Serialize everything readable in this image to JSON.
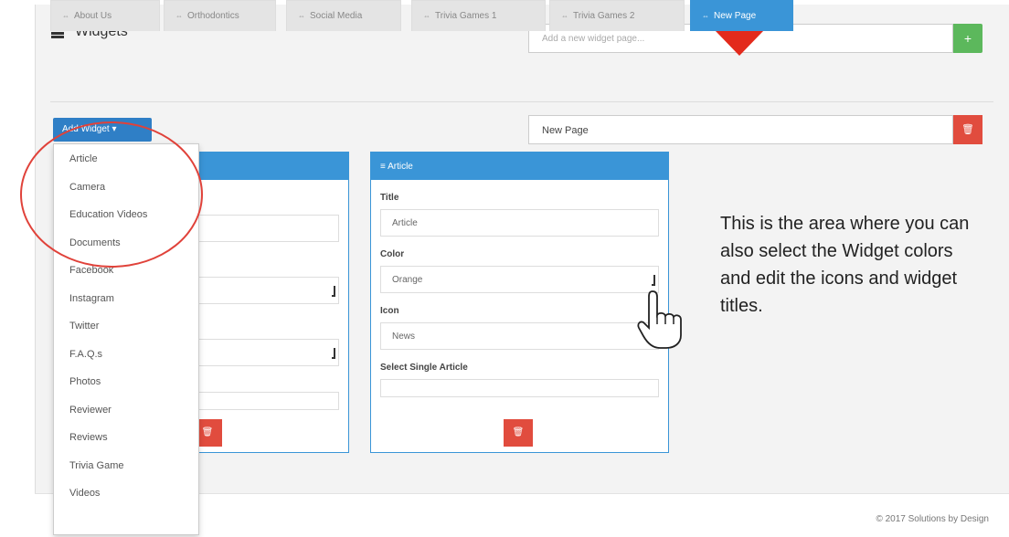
{
  "header": {
    "title": "Widgets",
    "icon": "list-icon"
  },
  "new_page_input": {
    "placeholder": "Add a new widget page..."
  },
  "add_button": {
    "label": "+"
  },
  "tabs": [
    {
      "label": "About Us",
      "active": false
    },
    {
      "label": "Orthodontics",
      "active": false
    },
    {
      "label": "Social Media",
      "active": false
    },
    {
      "label": "Trivia Games 1",
      "active": false
    },
    {
      "label": "Trivia Games 2",
      "active": false
    },
    {
      "label": "New Page",
      "active": true
    }
  ],
  "add_widget": {
    "label": "Add Widget ▾"
  },
  "page_name": {
    "value": "New Page"
  },
  "dropdown_items": [
    "Article",
    "Camera",
    "Education Videos",
    "Documents",
    "Facebook",
    "Instagram",
    "Twitter",
    "F.A.Q.s",
    "Photos",
    "Reviewer",
    "Reviews",
    "Trivia Game",
    "Videos"
  ],
  "widget": {
    "header": "Article",
    "title_label": "Title",
    "title_value": "Article",
    "color_label": "Color",
    "color_value": "Orange",
    "icon_label": "Icon",
    "icon_value": "News",
    "single_label": "Select Single Article"
  },
  "annotation": "This is the area where you can also select the Widget colors and edit the icons and widget titles.",
  "footer": {
    "copyright": "© 2017 Solutions by Design"
  },
  "colors": {
    "primary": "#3a95d7",
    "danger": "#e14c3e",
    "success": "#5cb85c",
    "annotation_red": "#e32a1c"
  }
}
